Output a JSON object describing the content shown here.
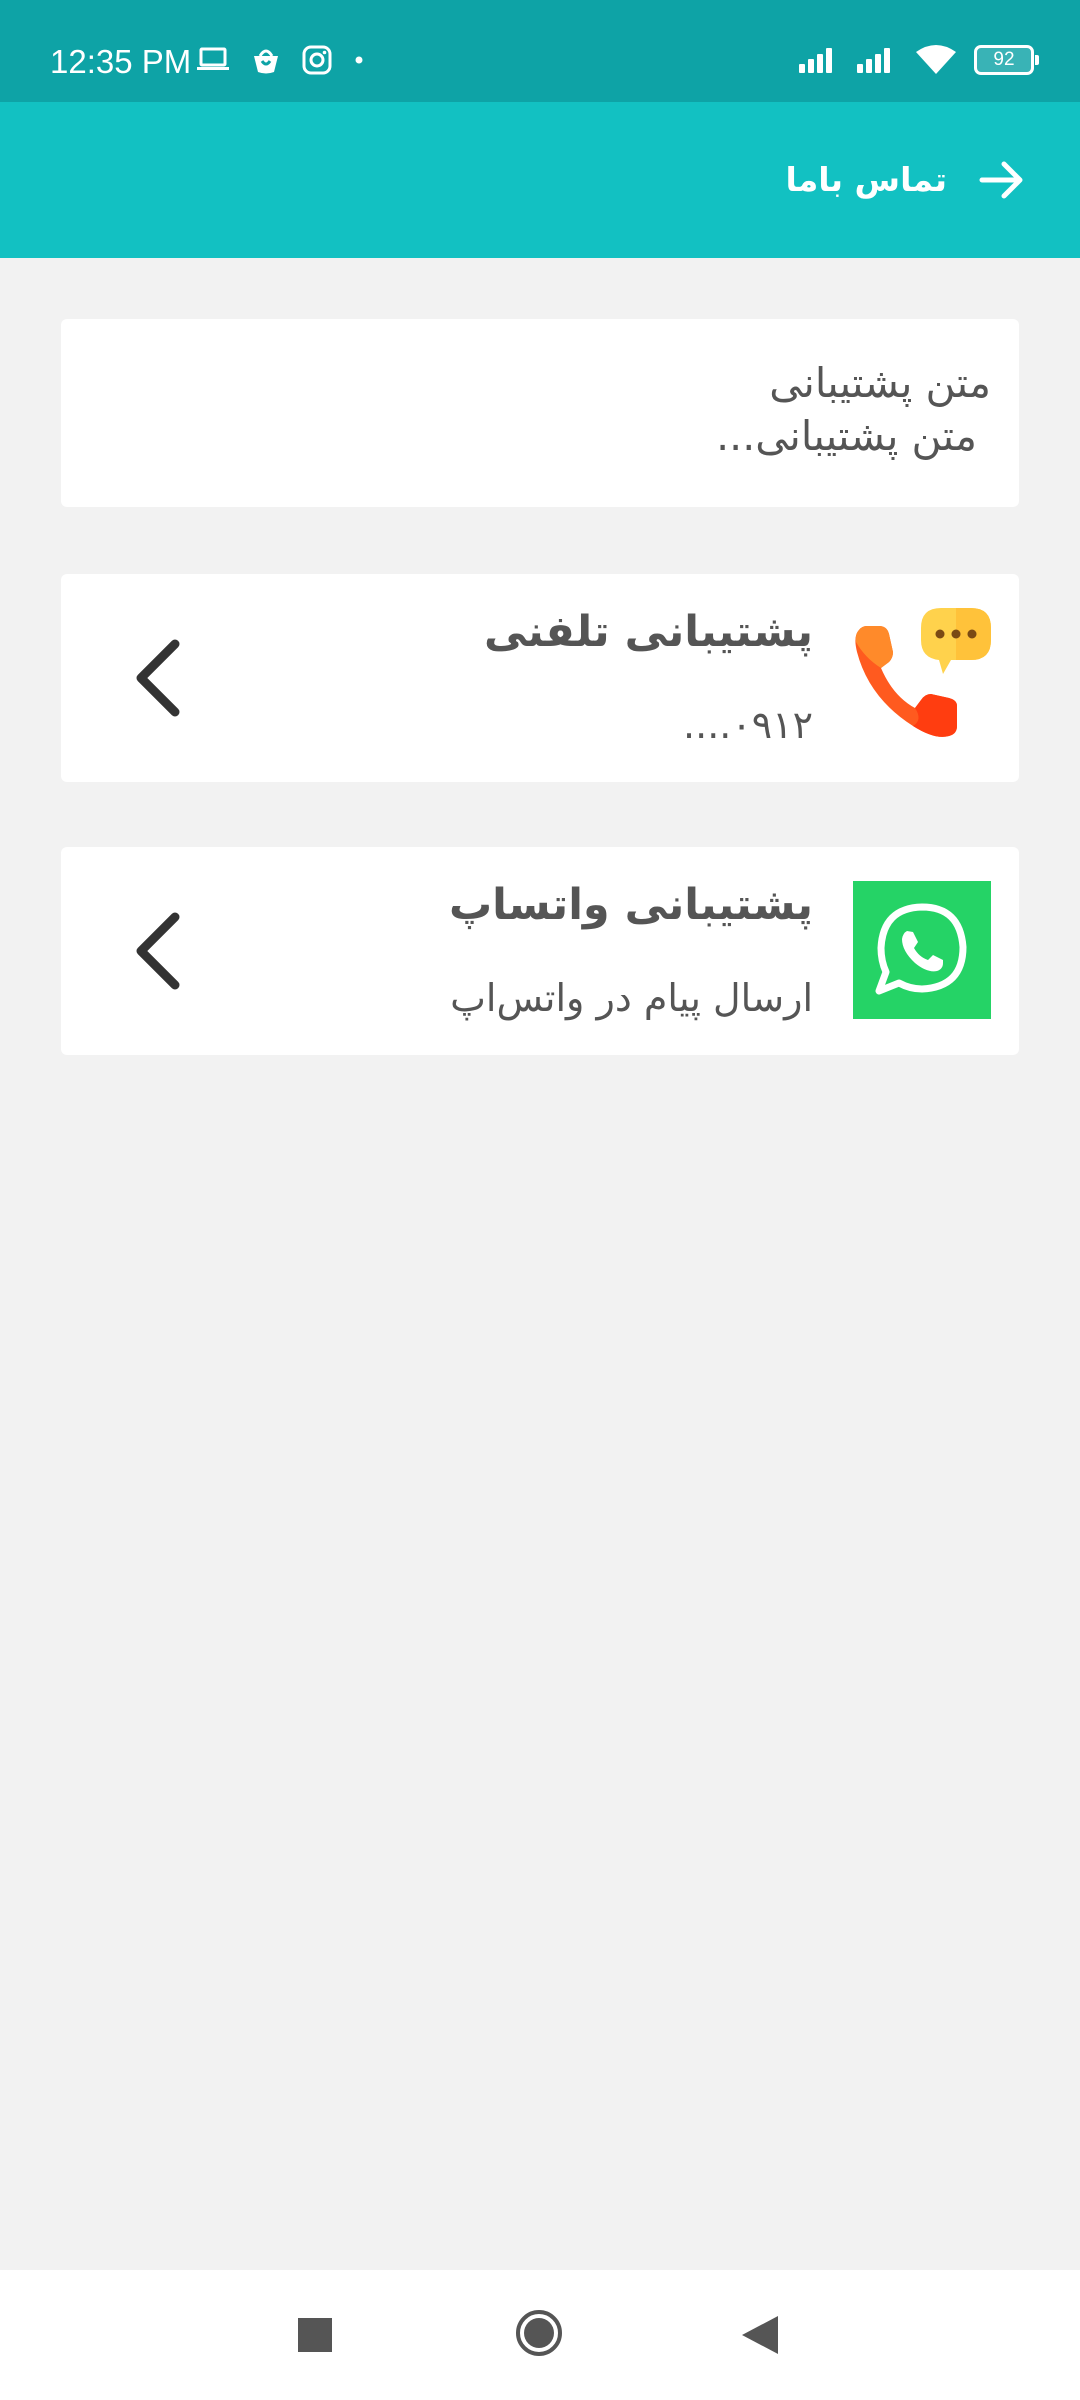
{
  "status_bar": {
    "time": "12:35 PM",
    "battery": "92",
    "icons": [
      "laptop-icon",
      "shopping-bag-icon",
      "instagram-icon",
      "dot-icon",
      "signal-icon",
      "signal-icon",
      "wifi-icon",
      "battery-icon"
    ]
  },
  "app_bar": {
    "title": "تماس باما",
    "back_icon": "arrow-right-icon"
  },
  "intro_card": {
    "line1": "متن پشتیبانی",
    "line2": "متن پشتیبانی..."
  },
  "phone_support": {
    "title": "پشتیبانی تلفنی",
    "subtitle": "۰۹۱۲....",
    "icon": "phone-chat-icon"
  },
  "whatsapp_support": {
    "title": "پشتیبانی واتساپ",
    "subtitle": "ارسال پیام در واتس‌اپ",
    "icon": "whatsapp-icon"
  },
  "colors": {
    "status_bar": "#0ea3a6",
    "app_bar": "#12c1c2",
    "background": "#f2f2f2",
    "card": "#ffffff",
    "text": "#555555",
    "whatsapp_green": "#25d366",
    "phone_orange": "#ff5a1f",
    "bubble_yellow": "#ffd24c"
  },
  "nav_bar": {
    "icons": [
      "recent-apps-icon",
      "home-icon",
      "back-icon"
    ]
  }
}
